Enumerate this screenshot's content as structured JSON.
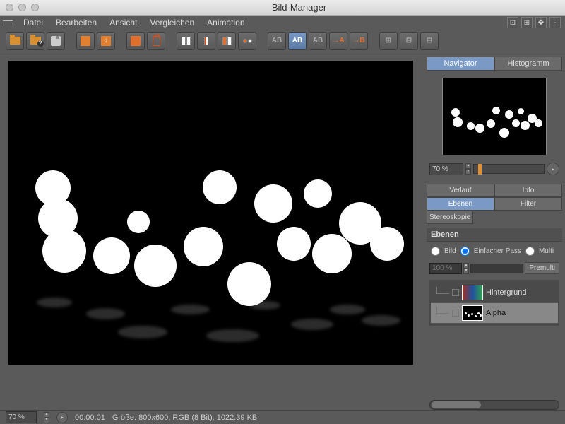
{
  "window": {
    "title": "Bild-Manager"
  },
  "menu": {
    "items": [
      "Datei",
      "Bearbeiten",
      "Ansicht",
      "Vergleichen",
      "Animation"
    ]
  },
  "navigator": {
    "tabs": {
      "navigator": "Navigator",
      "histogram": "Histogramm"
    },
    "zoom": "70 %"
  },
  "panel_tabs": {
    "verlauf": "Verlauf",
    "info": "Info",
    "ebenen": "Ebenen",
    "filter": "Filter",
    "stereo": "Stereoskopie"
  },
  "layers_panel": {
    "header": "Ebenen",
    "radio_bild": "Bild",
    "radio_pass": "Einfacher Pass",
    "radio_multi": "Multi",
    "opacity": "100 %",
    "premult": "Premulti",
    "layer_bg": "Hintergrund",
    "layer_alpha": "Alpha"
  },
  "status": {
    "zoom": "70 %",
    "time": "00:00:01",
    "info": "Größe: 800x600, RGB (8 Bit), 1022.39 KB"
  }
}
